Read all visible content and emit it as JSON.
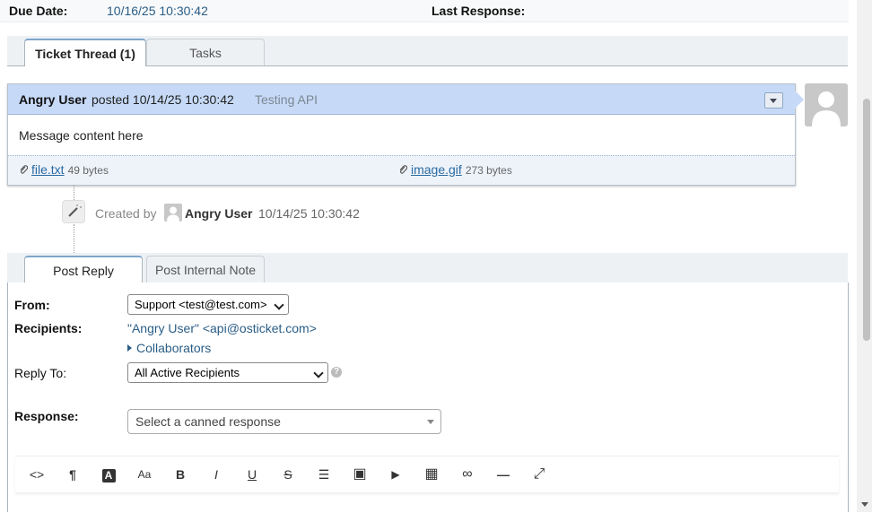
{
  "ticket_info": {
    "due_date_label": "Due Date:",
    "due_date_value": "10/16/25 10:30:42",
    "last_response_label": "Last Response:"
  },
  "tabs": [
    {
      "label": "Ticket Thread (1)",
      "active": true
    },
    {
      "label": "Tasks",
      "active": false
    }
  ],
  "thread_entry": {
    "author": "Angry User",
    "posted": "posted 10/14/25 10:30:42",
    "title": "Testing API",
    "body": "Message content here",
    "attachments": [
      {
        "name": "file.txt",
        "size": "49 bytes"
      },
      {
        "name": "image.gif",
        "size": "273 bytes"
      }
    ]
  },
  "event": {
    "prefix": "Created by",
    "author": "Angry User",
    "timestamp": "10/14/25 10:30:42"
  },
  "reply_tabs": [
    {
      "label": "Post Reply",
      "active": true
    },
    {
      "label": "Post Internal Note",
      "active": false
    }
  ],
  "reply_form": {
    "from_label": "From:",
    "from_value": "Support <test@test.com>",
    "recipients_label": "Recipients:",
    "recipients_value": "\"Angry User\" <api@osticket.com>",
    "collaborators_label": "Collaborators",
    "reply_to_label": "Reply To:",
    "reply_to_value": "All Active Recipients",
    "help_glyph": "?",
    "response_label": "Response:",
    "canned_placeholder": "Select a canned response"
  },
  "editor_toolbar": [
    {
      "name": "html-code-icon",
      "glyph": "<>"
    },
    {
      "name": "paragraph-icon",
      "glyph": "¶"
    },
    {
      "name": "text-color-icon",
      "glyph": "A"
    },
    {
      "name": "font-size-icon",
      "glyph": "Aa"
    },
    {
      "name": "bold-icon",
      "glyph": "B"
    },
    {
      "name": "italic-icon",
      "glyph": "I"
    },
    {
      "name": "underline-icon",
      "glyph": "U"
    },
    {
      "name": "strikethrough-icon",
      "glyph": "S"
    },
    {
      "name": "list-icon",
      "glyph": "☰"
    },
    {
      "name": "image-icon",
      "glyph": "▣"
    },
    {
      "name": "video-icon",
      "glyph": "▶"
    },
    {
      "name": "table-icon",
      "glyph": "▦"
    },
    {
      "name": "link-icon",
      "glyph": "∞"
    },
    {
      "name": "horizontal-rule-icon",
      "glyph": "—"
    },
    {
      "name": "fullscreen-icon",
      "glyph": "⤢"
    }
  ],
  "colors": {
    "header_blue": "#c6daf7",
    "link_blue": "#2a6aa0",
    "value_blue": "#2a5d86"
  }
}
